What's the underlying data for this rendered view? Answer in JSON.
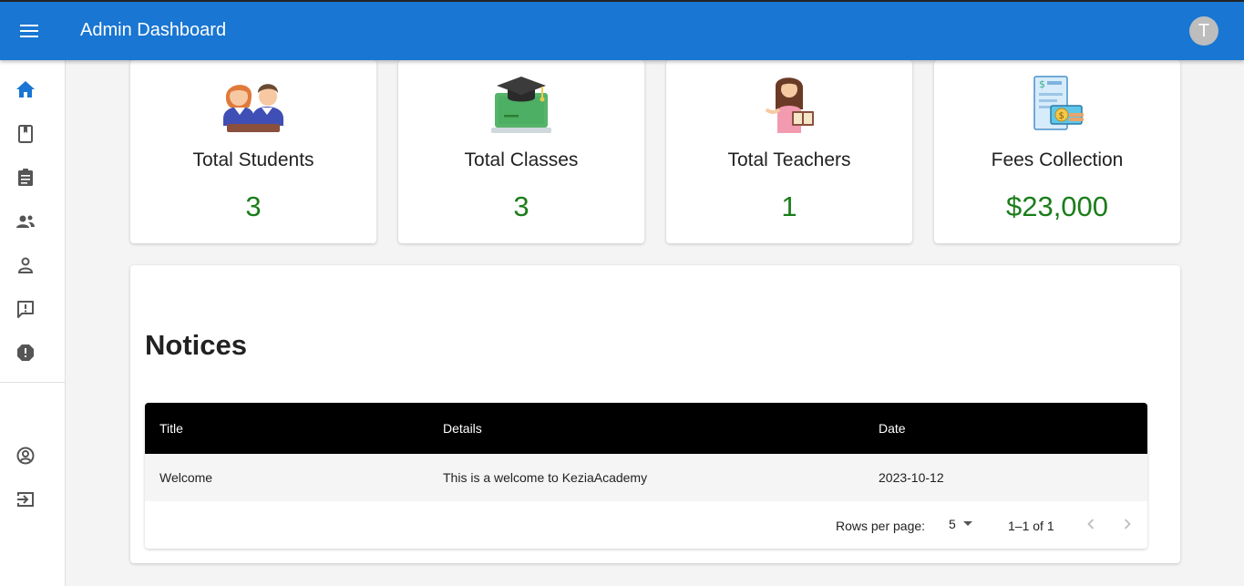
{
  "appbar": {
    "title": "Admin Dashboard",
    "avatar_letter": "T"
  },
  "sidebar": {
    "items": [
      {
        "icon": "home-icon"
      },
      {
        "icon": "class-icon"
      },
      {
        "icon": "assignment-icon"
      },
      {
        "icon": "teachers-icon"
      },
      {
        "icon": "student-icon"
      },
      {
        "icon": "feedback-icon"
      },
      {
        "icon": "complain-icon"
      },
      {
        "icon": "profile-icon"
      },
      {
        "icon": "logout-icon"
      }
    ]
  },
  "stats": [
    {
      "label": "Total Students",
      "value": "3",
      "icon": "students-illustration"
    },
    {
      "label": "Total Classes",
      "value": "3",
      "icon": "classes-illustration"
    },
    {
      "label": "Total Teachers",
      "value": "1",
      "icon": "teacher-illustration"
    },
    {
      "label": "Fees Collection",
      "value": "$23,000",
      "icon": "fees-illustration"
    }
  ],
  "notices": {
    "title": "Notices",
    "columns": [
      "Title",
      "Details",
      "Date"
    ],
    "rows": [
      [
        "Welcome",
        "This is a welcome to KeziaAcademy",
        "2023-10-12"
      ]
    ],
    "pagination": {
      "rows_per_page_label": "Rows per page:",
      "rows_per_page": "5",
      "range": "1–1 of 1"
    }
  },
  "colors": {
    "appbar": "#1976d2",
    "value": "#1b7d1b",
    "active_nav": "#1976d2"
  }
}
